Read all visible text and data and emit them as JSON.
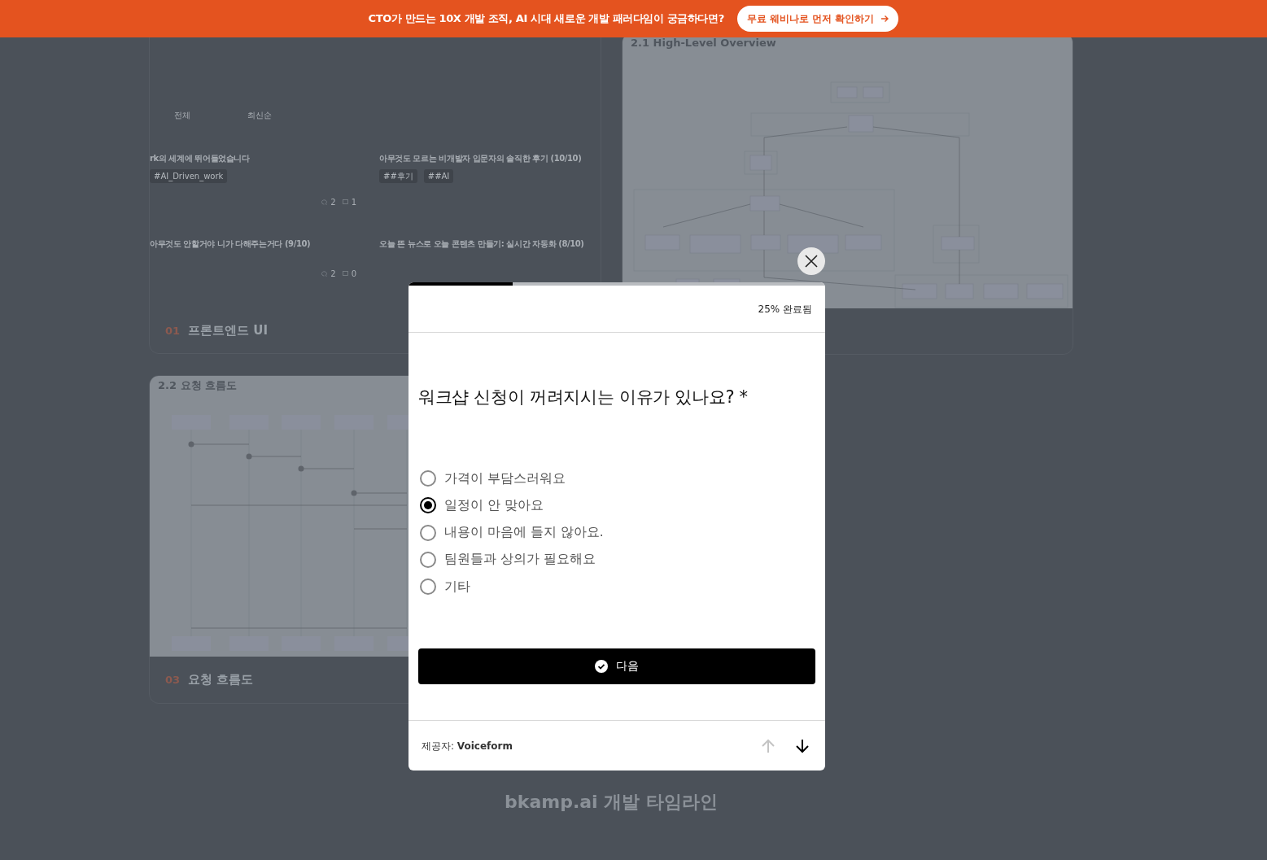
{
  "banner": {
    "text": "CTO가 만드는 10X 개발 조직, AI 시대 새로운 개발 패러다임이 궁금하다면?",
    "button": "무료 웨비나로 먼저 확인하기"
  },
  "cards": [
    {
      "kind": "feed",
      "number": "01",
      "title": "프론트엔드 UI",
      "filters": [
        "전체",
        "최신순"
      ],
      "posts": [
        {
          "title": "rk의 세계에 뛰어들었습니다",
          "tags": [
            "#AI_Driven_work"
          ],
          "stats": [
            "2",
            "1"
          ]
        },
        {
          "title": "아무것도 모르는 비개발자 입문자의 솔직한 후기 (10/10)",
          "tags": [
            "##후기",
            "##AI"
          ]
        },
        {
          "title": "아무것도 안할거야 니가 다해주는거다 (9/10)",
          "stats": [
            "2",
            "0"
          ]
        },
        {
          "title": "오늘 뜬 뉴스로 오늘 콘텐츠 만들기: 실시간 자동화 (8/10)"
        }
      ]
    },
    {
      "kind": "diagram",
      "image_title": "2.1 High-Level Overview"
    },
    {
      "kind": "sequence",
      "image_title": "2.2 요청 흐름도",
      "number": "03",
      "title": "요청 흐름도"
    }
  ],
  "section_title": "bkamp.ai 개발 타임라인",
  "survey": {
    "progress": {
      "level": 0.25
    },
    "progress_text": "25% 완료됨",
    "question": "워크샵 신청이 꺼려지시는 이유가 있나요? *",
    "options": [
      {
        "label": "가격이 부담스러워요",
        "selected": false
      },
      {
        "label": "일정이 안 맞아요",
        "selected": true
      },
      {
        "label": "내용이 마음에 들지 않아요.",
        "selected": false
      },
      {
        "label": "팀원들과 상의가 필요해요",
        "selected": false
      },
      {
        "label": "기타",
        "selected": false
      }
    ],
    "submit": "다음",
    "provider": "제공자: **Voiceform**",
    "nav": {
      "up_disabled": true,
      "down_disabled": false
    }
  }
}
